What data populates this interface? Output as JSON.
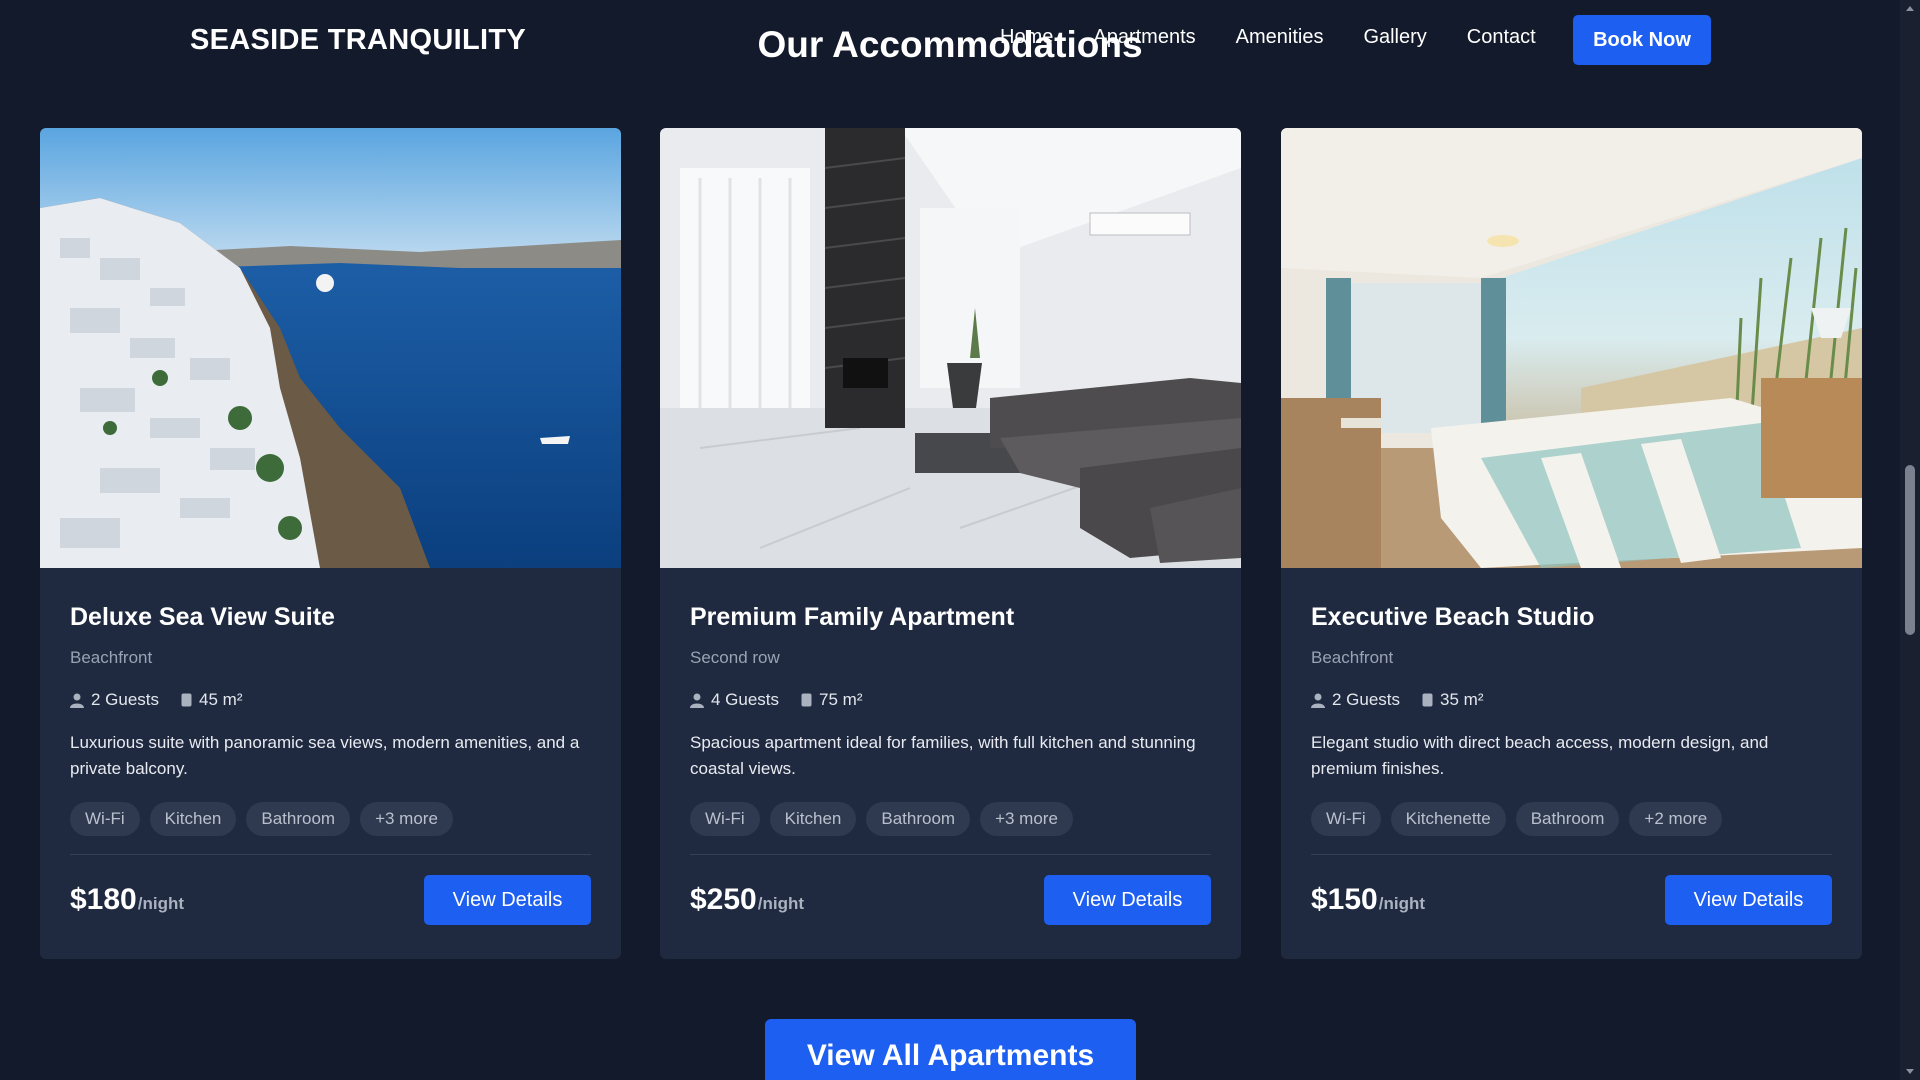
{
  "header": {
    "logo": "SEASIDE TRANQUILITY",
    "section_title": "Our Accommodations",
    "nav": [
      "Home",
      "Apartments",
      "Amenities",
      "Gallery",
      "Contact"
    ],
    "book_label": "Book Now"
  },
  "cards": [
    {
      "image": "santorini-coast-photo",
      "title": "Deluxe Sea View Suite",
      "location": "Beachfront",
      "guests": "2 Guests",
      "size": "45 m²",
      "description": "Luxurious suite with panoramic sea views, modern amenities, and a private balcony.",
      "tags": [
        "Wi-Fi",
        "Kitchen",
        "Bathroom",
        "+3 more"
      ],
      "price": "$180",
      "price_unit": "/night",
      "button": "View Details"
    },
    {
      "image": "modern-living-room-photo",
      "title": "Premium Family Apartment",
      "location": "Second row",
      "guests": "4 Guests",
      "size": "75 m²",
      "description": "Spacious apartment ideal for families, with full kitchen and stunning coastal views.",
      "tags": [
        "Wi-Fi",
        "Kitchen",
        "Bathroom",
        "+3 more"
      ],
      "price": "$250",
      "price_unit": "/night",
      "button": "View Details"
    },
    {
      "image": "beach-bedroom-photo",
      "title": "Executive Beach Studio",
      "location": "Beachfront",
      "guests": "2 Guests",
      "size": "35 m²",
      "description": "Elegant studio with direct beach access, modern design, and premium finishes.",
      "tags": [
        "Wi-Fi",
        "Kitchenette",
        "Bathroom",
        "+2 more"
      ],
      "price": "$150",
      "price_unit": "/night",
      "button": "View Details"
    }
  ],
  "view_all_label": "View All Apartments",
  "colors": {
    "background": "#131a2b",
    "card": "#1f2a40",
    "accent": "#1d5ff0",
    "tag_bg": "#2f3a50"
  }
}
